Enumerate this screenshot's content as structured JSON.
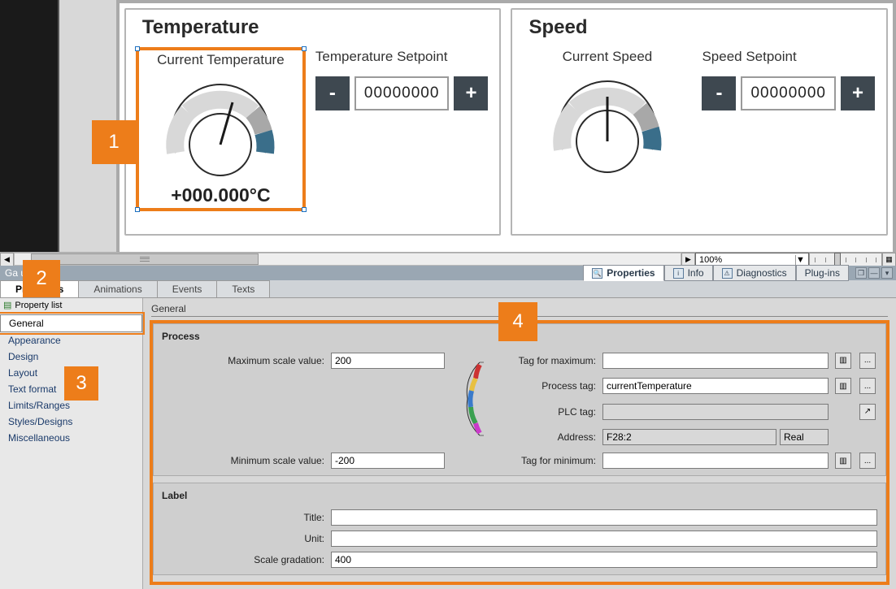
{
  "callouts": {
    "c1": "1",
    "c2": "2",
    "c3": "3",
    "c4": "4"
  },
  "canvas": {
    "panels": [
      {
        "title": "Temperature",
        "gauge": {
          "label": "Current Temperature",
          "value": "+000.000°C",
          "selected": true
        },
        "setpoint": {
          "label": "Temperature Setpoint",
          "minus": "-",
          "value": "00000000",
          "plus": "+"
        }
      },
      {
        "title": "Speed",
        "gauge": {
          "label": "Current Speed",
          "value": "",
          "selected": false
        },
        "setpoint": {
          "label": "Speed Setpoint",
          "minus": "-",
          "value": "00000000",
          "plus": "+"
        }
      }
    ],
    "zoom": "100%"
  },
  "object_title": "Ga           uge]",
  "inspector_tabs": {
    "properties": "Properties",
    "info": "Info",
    "diagnostics": "Diagnostics",
    "plugins": "Plug-ins"
  },
  "main_tabs": {
    "properties": "Properties",
    "animations": "Animations",
    "events": "Events",
    "texts": "Texts"
  },
  "sidebar": {
    "header": "Property list",
    "items": [
      "General",
      "Appearance",
      "Design",
      "Layout",
      "Text format",
      "Limits/Ranges",
      "Styles/Designs",
      "Miscellaneous"
    ],
    "selected": "General"
  },
  "form": {
    "section": "General",
    "process": {
      "title": "Process",
      "max_label": "Maximum scale value:",
      "max_value": "200",
      "tag_max_label": "Tag for maximum:",
      "tag_max_value": "",
      "process_tag_label": "Process tag:",
      "process_tag_value": "currentTemperature",
      "plc_tag_label": "PLC tag:",
      "plc_tag_value": "",
      "address_label": "Address:",
      "address_value": "F28:2",
      "address_type": "Real",
      "min_label": "Minimum scale value:",
      "min_value": "-200",
      "tag_min_label": "Tag for minimum:",
      "tag_min_value": ""
    },
    "label": {
      "title": "Label",
      "title_label": "Title:",
      "title_value": "",
      "unit_label": "Unit:",
      "unit_value": "",
      "grad_label": "Scale gradation:",
      "grad_value": "400"
    }
  }
}
